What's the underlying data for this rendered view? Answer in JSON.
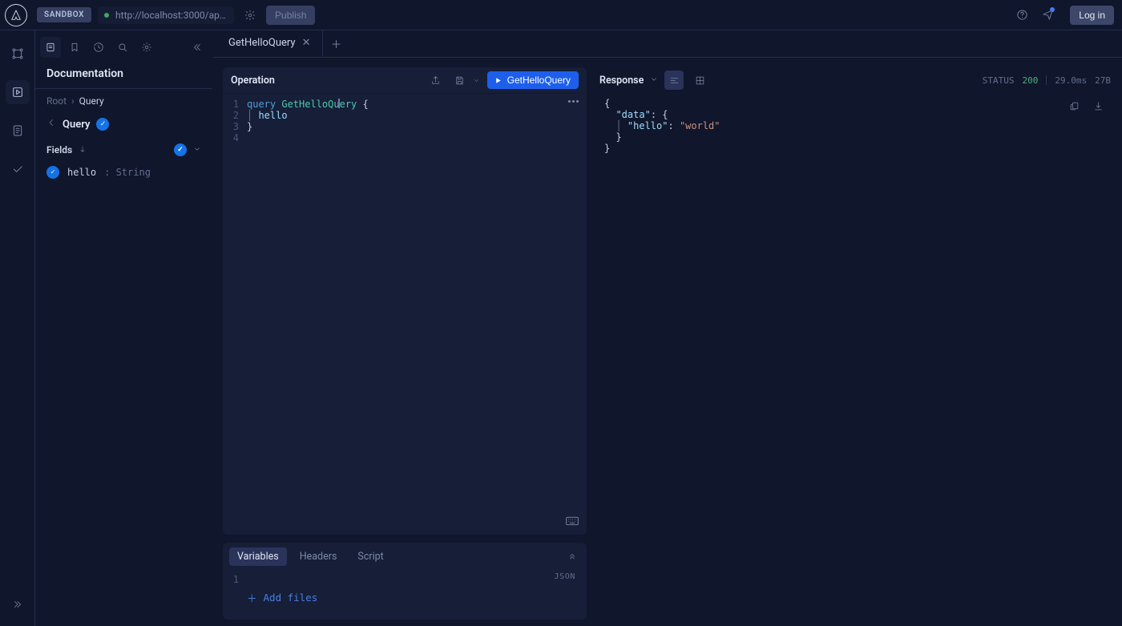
{
  "topbar": {
    "env_badge": "SANDBOX",
    "url": "http://localhost:3000/api…",
    "publish": "Publish",
    "login": "Log in"
  },
  "sidebar": {
    "heading": "Documentation",
    "crumb_root": "Root",
    "crumb_sep": "›",
    "crumb_current": "Query",
    "back_title": "Query",
    "fields_label": "Fields",
    "field_name": "hello",
    "field_sep": ": ",
    "field_type": "String"
  },
  "tabs": {
    "active": "GetHelloQuery"
  },
  "operation": {
    "title": "Operation",
    "run_label": "GetHelloQuery",
    "lines": [
      "1",
      "2",
      "3",
      "4"
    ],
    "code": {
      "kw": "query",
      "name": "GetHelloQuery",
      "brace_open": "{",
      "field": "hello",
      "brace_close": "}"
    }
  },
  "bottom": {
    "tab_variables": "Variables",
    "tab_headers": "Headers",
    "tab_script": "Script",
    "line1": "1",
    "json_label": "JSON",
    "add_files": "Add files"
  },
  "response": {
    "title": "Response",
    "status_label": "STATUS",
    "status_code": "200",
    "time": "29.0ms",
    "size": "27B",
    "code": {
      "brace_open": "{",
      "data_key": "\"data\"",
      "colon": ": ",
      "hello_key": "\"hello\"",
      "hello_val": "\"world\"",
      "brace_close": "}"
    }
  }
}
